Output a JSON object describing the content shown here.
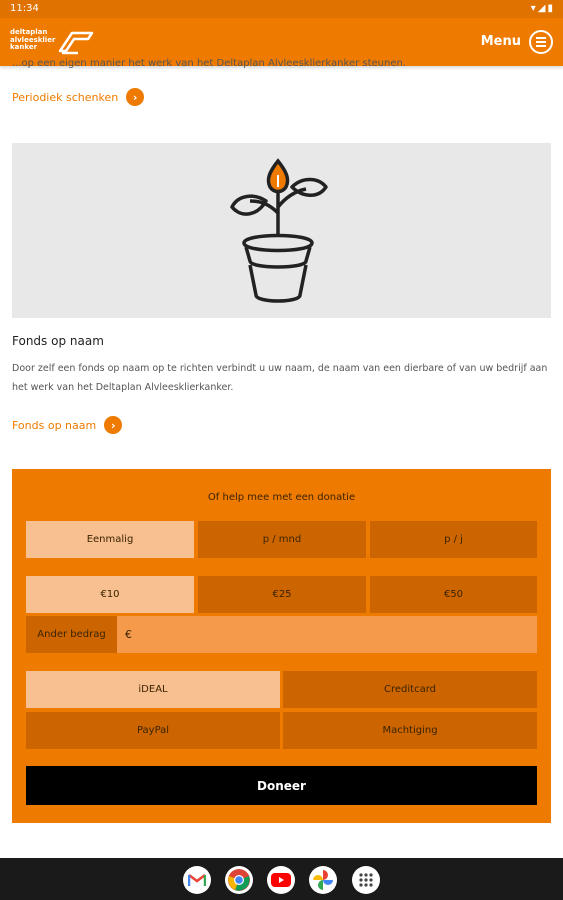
{
  "status_bar": {
    "time": "11:34",
    "icons": "▾◢▮"
  },
  "header": {
    "logo_lines": [
      "deltaplan",
      "alvleesklier",
      "kanker"
    ],
    "menu_label": "Menu"
  },
  "section_clipped_text": "...op een eigen manier het werk van het Deltaplan Alvleesklierkanker steunen.",
  "periodiek_link": {
    "label": "Periodiek schenken",
    "arrow": "›"
  },
  "fonds": {
    "title": "Fonds op naam",
    "description": "Door zelf een fonds op naam op te richten verbindt u uw naam, de naam van een dierbare of van uw bedrijf aan het werk van het Deltaplan Alvleesklierkanker.",
    "link_label": "Fonds op naam",
    "arrow": "›"
  },
  "donation": {
    "title": "Of help mee met een donatie",
    "frequency": [
      "Eenmalig",
      "p / mnd",
      "p / j"
    ],
    "frequency_selected": 0,
    "amounts": [
      "€10",
      "€25",
      "€50"
    ],
    "amount_selected": 0,
    "other_amount_label": "Ander bedrag",
    "other_amount_value": "€",
    "methods": [
      "iDEAL",
      "Creditcard",
      "PayPal",
      "Machtiging"
    ],
    "method_selected": 0,
    "submit_label": "Doneer"
  },
  "colors": {
    "brand": "#ef7a00",
    "segment": "#cc6500",
    "selected": "#f8bf90"
  },
  "nav_apps": [
    "gmail-icon",
    "chrome-icon",
    "youtube-icon",
    "photos-icon",
    "apps-icon"
  ]
}
